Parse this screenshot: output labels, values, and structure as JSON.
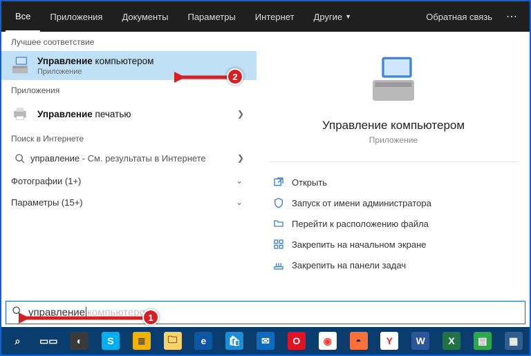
{
  "topbar": {
    "tabs": [
      "Все",
      "Приложения",
      "Документы",
      "Параметры",
      "Интернет",
      "Другие"
    ],
    "feedback": "Обратная связь"
  },
  "left": {
    "best_match": "Лучшее соответствие",
    "result_main": {
      "title_bold": "Управление",
      "title_rest": " компьютером",
      "subtitle": "Приложение"
    },
    "apps_header": "Приложения",
    "result_print": {
      "title_bold": "Управление",
      "title_rest": " печатью"
    },
    "web_header": "Поиск в Интернете",
    "web_result": {
      "bold": "управление",
      "rest": " - См. результаты в Интернете"
    },
    "photos_row": "Фотографии (1+)",
    "settings_row": "Параметры (15+)"
  },
  "preview": {
    "title": "Управление компьютером",
    "subtitle": "Приложение",
    "actions": {
      "open": "Открыть",
      "run_admin": "Запуск от имени администратора",
      "open_location": "Перейти к расположению файла",
      "pin_start": "Закрепить на начальном экране",
      "pin_taskbar": "Закрепить на панели задач"
    }
  },
  "search": {
    "value": "управление",
    "ghost": "компьютером"
  },
  "taskbar": {
    "items": [
      {
        "name": "search",
        "label": "⌕",
        "bg": "transparent",
        "fg": "#fff"
      },
      {
        "name": "taskview",
        "label": "▭▭",
        "bg": "transparent",
        "fg": "#fff"
      },
      {
        "name": "app-circle",
        "label": "◐",
        "bg": "#3a3a3a",
        "fg": "#fff"
      },
      {
        "name": "skype",
        "label": "S",
        "bg": "#00aff0",
        "fg": "#fff"
      },
      {
        "name": "app-yellow",
        "label": "≣",
        "bg": "#f2b200",
        "fg": "#333"
      },
      {
        "name": "file-explorer",
        "label": "🗀",
        "bg": "#f8d36b",
        "fg": "#5a4a1a"
      },
      {
        "name": "edge",
        "label": "e",
        "bg": "#0b57a4",
        "fg": "#fff"
      },
      {
        "name": "store",
        "label": "🛍",
        "bg": "#1e8bd6",
        "fg": "#fff"
      },
      {
        "name": "mail",
        "label": "✉",
        "bg": "#0f6cbd",
        "fg": "#fff"
      },
      {
        "name": "opera",
        "label": "O",
        "bg": "#e01224",
        "fg": "#fff"
      },
      {
        "name": "chrome",
        "label": "◉",
        "bg": "#fff",
        "fg": "#ea4335"
      },
      {
        "name": "firefox",
        "label": "◓",
        "bg": "#ff7139",
        "fg": "#331e54"
      },
      {
        "name": "yandex",
        "label": "Y",
        "bg": "#fff",
        "fg": "#e52620"
      },
      {
        "name": "word",
        "label": "W",
        "bg": "#2b579a",
        "fg": "#fff"
      },
      {
        "name": "excel",
        "label": "X",
        "bg": "#217346",
        "fg": "#fff"
      },
      {
        "name": "app-doc",
        "label": "▤",
        "bg": "#2aa84a",
        "fg": "#fff"
      },
      {
        "name": "app-image",
        "label": "▦",
        "bg": "#2f5e8e",
        "fg": "#fff"
      }
    ]
  },
  "callouts": {
    "badge1": "1",
    "badge2": "2"
  }
}
